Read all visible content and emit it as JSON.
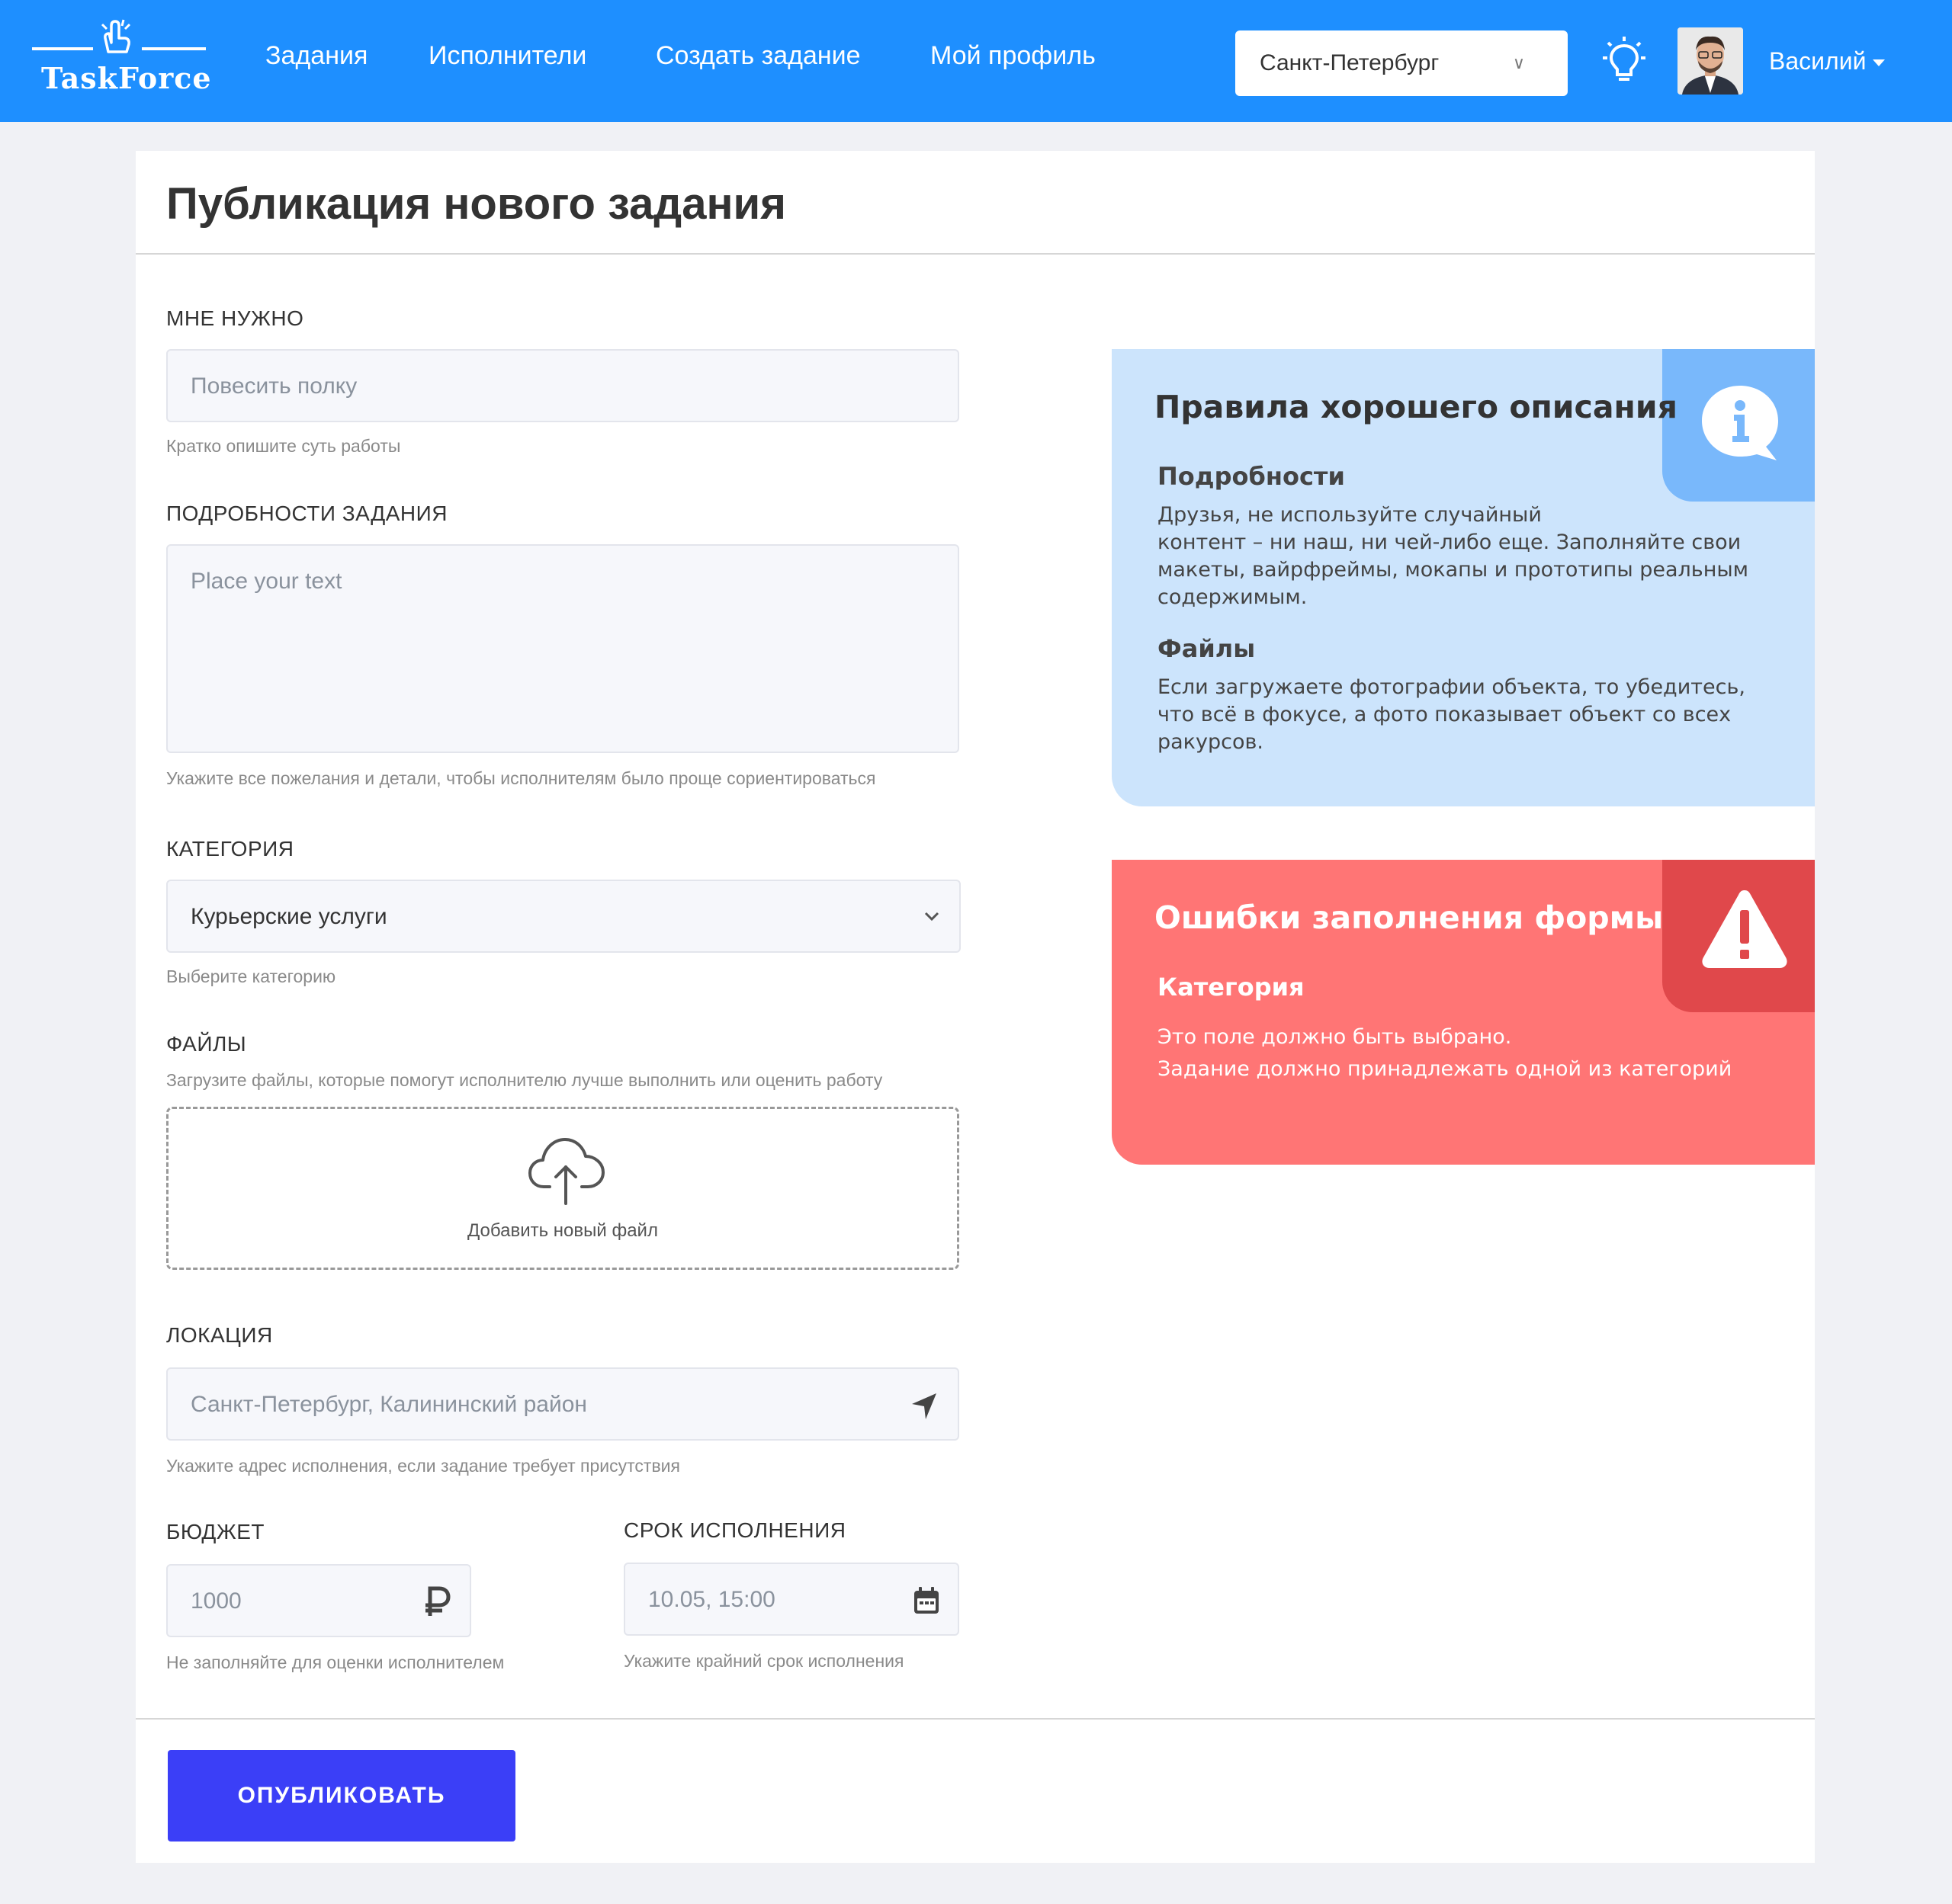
{
  "header": {
    "logo_text": "TaskForce",
    "nav": [
      "Задания",
      "Исполнители",
      "Создать задание",
      "Мой профиль"
    ],
    "city": "Санкт-Петербург",
    "user_name": "Василий"
  },
  "page": {
    "title": "Публикация нового задания",
    "submit_label": "ОПУБЛИКОВАТЬ"
  },
  "form": {
    "need": {
      "label": "МНЕ НУЖНО",
      "placeholder": "Повесить полку",
      "hint": "Кратко опишите суть работы"
    },
    "details": {
      "label": "ПОДРОБНОСТИ ЗАДАНИЯ",
      "placeholder": "Place your text",
      "hint": "Укажите все пожелания и детали, чтобы исполнителям было проще сориентироваться"
    },
    "category": {
      "label": "КАТЕГОРИЯ",
      "value": "Курьерские услуги",
      "hint": "Выберите категорию"
    },
    "files": {
      "label": "ФАЙЛЫ",
      "hint": "Загрузите файлы, которые помогут исполнителю лучше выполнить или оценить работу",
      "add_label": "Добавить новый файл"
    },
    "location": {
      "label": "ЛОКАЦИЯ",
      "placeholder": "Санкт-Петербург, Калининский район",
      "hint": "Укажите адрес исполнения, если задание требует присутствия"
    },
    "budget": {
      "label": "БЮДЖЕТ",
      "placeholder": "1000",
      "hint": "Не заполняйте для оценки исполнителем",
      "currency_icon": "ruble-icon"
    },
    "deadline": {
      "label": "СРОК ИСПОЛНЕНИЯ",
      "placeholder": "10.05, 15:00",
      "hint": "Укажите крайний срок исполнения"
    }
  },
  "rules_panel": {
    "title": "Правила хорошего описания",
    "sections": [
      {
        "heading": "Подробности",
        "text": "Друзья, не используйте случайный\nконтент – ни наш, ни чей-либо еще. Заполняйте свои\nмакеты, вайрфреймы, мокапы и прототипы реальным\nсодержимым."
      },
      {
        "heading": "Файлы",
        "text": "Если загружаете фотографии объекта, то убедитесь,\nчто всё в фокусе, а фото показывает объект со всех\nракурсов."
      }
    ]
  },
  "errors_panel": {
    "title": "Ошибки заполнения формы",
    "heading": "Категория",
    "text": "Это поле должно быть выбрано.\nЗадание должно принадлежать одной из категорий"
  },
  "colors": {
    "header": "#1e8fff",
    "primary_button": "#3b3ff7",
    "rules_panel_bg": "#cce4fc",
    "rules_panel_corner": "#79b8fb",
    "errors_panel_bg": "#ff7575",
    "errors_panel_corner": "#e0484b"
  }
}
